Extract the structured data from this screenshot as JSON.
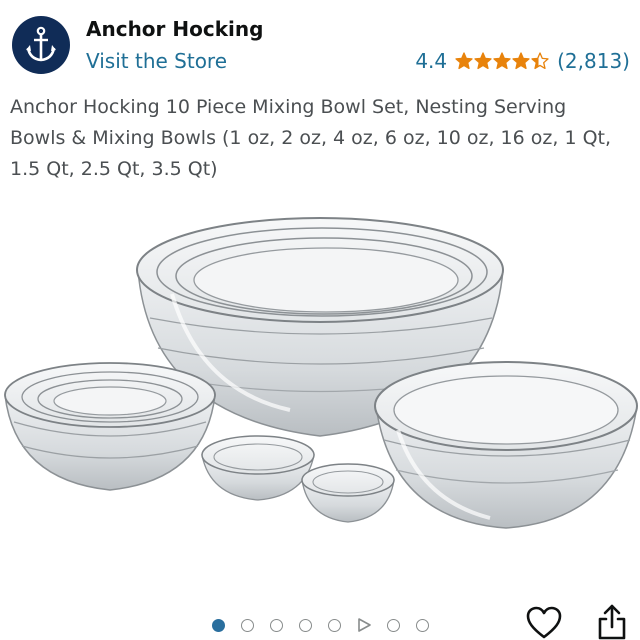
{
  "header": {
    "brand_name": "Anchor Hocking",
    "visit_store": "Visit the Store",
    "logo_icon": "anchor-icon",
    "colors": {
      "logo_bg": "#102c57",
      "link": "#1f6f96",
      "star": "#e8830c"
    }
  },
  "rating": {
    "score": "4.4",
    "stars_value": 4.4,
    "stars_max": 5,
    "count": "(2,813)"
  },
  "product": {
    "title": "Anchor Hocking 10 Piece Mixing Bowl Set, Nesting Serving Bowls & Mixing Bowls (1 oz, 2 oz, 4 oz, 6 oz, 10 oz, 16 oz, 1 Qt, 1.5 Qt, 2.5 Qt, 3.5 Qt)",
    "image": "glass-mixing-bowl-set-photo"
  },
  "carousel": {
    "total_slides": 8,
    "active_index": 0,
    "video_slide_index": 5,
    "active_color": "#2a6f9e"
  },
  "actions": {
    "wishlist_icon": "heart-icon",
    "share_icon": "share-icon"
  }
}
